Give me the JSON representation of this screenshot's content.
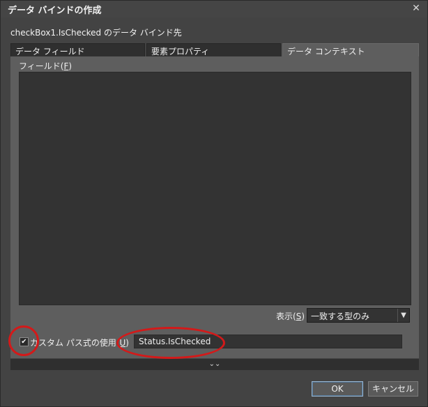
{
  "window": {
    "title": "データ バインドの作成"
  },
  "subtitle": "checkBox1.IsChecked のデータ バインド先",
  "tabs": [
    {
      "label": "データ フィールド"
    },
    {
      "label": "要素プロパティ"
    },
    {
      "label": "データ コンテキスト"
    }
  ],
  "fields": {
    "label": "フィールド(",
    "accel": "F",
    "label_end": ")"
  },
  "show": {
    "label": "表示(",
    "accel": "S",
    "label_end": ")",
    "selected": "一致する型のみ"
  },
  "custom_path": {
    "checked": true,
    "label": "カスタム パス式の使用(",
    "accel": "U",
    "label_end": ")",
    "value": "Status.IsChecked"
  },
  "buttons": {
    "ok": "OK",
    "cancel": "キャンセル"
  },
  "colors": {
    "annotation": "#d41919",
    "background": "#434343",
    "panel": "#5e5e5e"
  }
}
